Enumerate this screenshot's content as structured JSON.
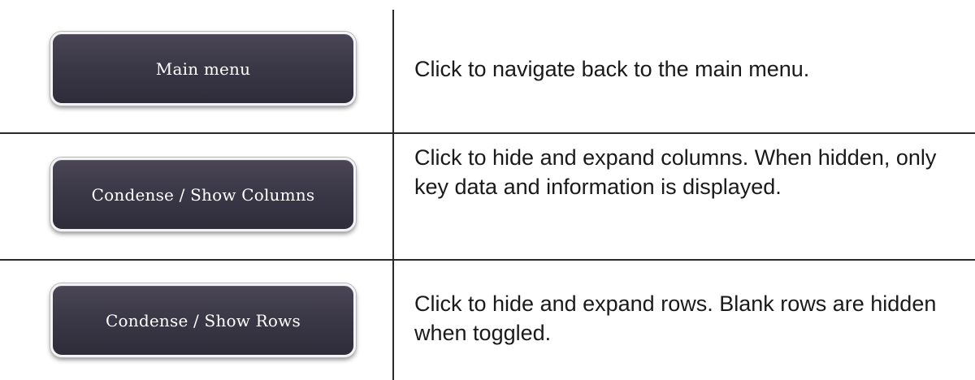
{
  "rows": [
    {
      "button_label": "Main menu",
      "description": "Click to navigate back to the main menu."
    },
    {
      "button_label": "Condense / Show Columns",
      "description": "Click to hide and expand columns. When hidden, only key data and information is displayed."
    },
    {
      "button_label": "Condense / Show Rows",
      "description": "Click to hide and expand rows. Blank rows are hidden when toggled."
    }
  ],
  "colors": {
    "button_bg": "#3b3847",
    "button_border": "#f4f4f6",
    "button_text": "#ffffff",
    "rule": "#2a2a2a",
    "text": "#1a1a1a"
  }
}
